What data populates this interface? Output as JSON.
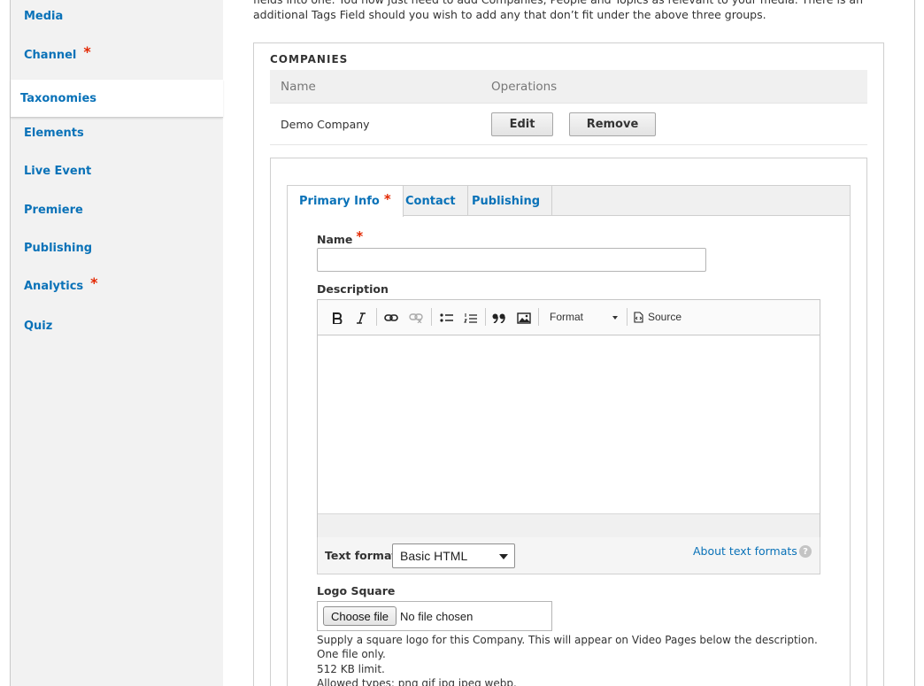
{
  "sidebar": {
    "items": [
      {
        "label": "Media",
        "required": false
      },
      {
        "label": "Channel",
        "required": true
      },
      {
        "label": "Taxonomies",
        "required": false,
        "active": true
      },
      {
        "label": "Elements",
        "required": false
      },
      {
        "label": "Live Event",
        "required": false
      },
      {
        "label": "Premiere",
        "required": false
      },
      {
        "label": "Publishing",
        "required": false
      },
      {
        "label": "Analytics",
        "required": true
      },
      {
        "label": "Quiz",
        "required": false
      }
    ],
    "required_marker": "*"
  },
  "intro": {
    "line1": "fields into one. You now just need to add Companies, People and Topics as relevant to your media. There is an",
    "line2": "additional Tags Field should you wish to add any that don’t fit under the above three groups."
  },
  "companies": {
    "legend": "COMPANIES",
    "columns": {
      "name": "Name",
      "operations": "Operations"
    },
    "rows": [
      {
        "name": "Demo Company",
        "edit_label": "Edit",
        "remove_label": "Remove"
      }
    ]
  },
  "form": {
    "tabs": [
      {
        "label": "Primary Info",
        "required": true,
        "active": true
      },
      {
        "label": "Contact",
        "required": false
      },
      {
        "label": "Publishing",
        "required": false
      }
    ],
    "name_label": "Name",
    "name_value": "",
    "description_label": "Description",
    "editor": {
      "tools": [
        "bold-icon",
        "italic-icon",
        "link-icon",
        "unlink-icon",
        "bulleted-list-icon",
        "numbered-list-icon",
        "blockquote-icon",
        "image-icon"
      ],
      "format_label": "Format",
      "source_label": "Source"
    },
    "text_format_label": "Text format",
    "text_format_value": "Basic HTML",
    "about_link": "About text formats",
    "help_glyph": "?",
    "logo_label": "Logo Square",
    "choose_file_label": "Choose file",
    "file_status": "No file chosen",
    "logo_help": [
      "Supply a square logo for this Company. This will appear on Video Pages below the description.",
      "One file only.",
      "512 KB limit.",
      "Allowed types: png gif jpg jpeg webp."
    ]
  },
  "colors": {
    "link": "#0a72b8",
    "required": "#e32700",
    "sidebar_bg": "#f2f2f2"
  }
}
